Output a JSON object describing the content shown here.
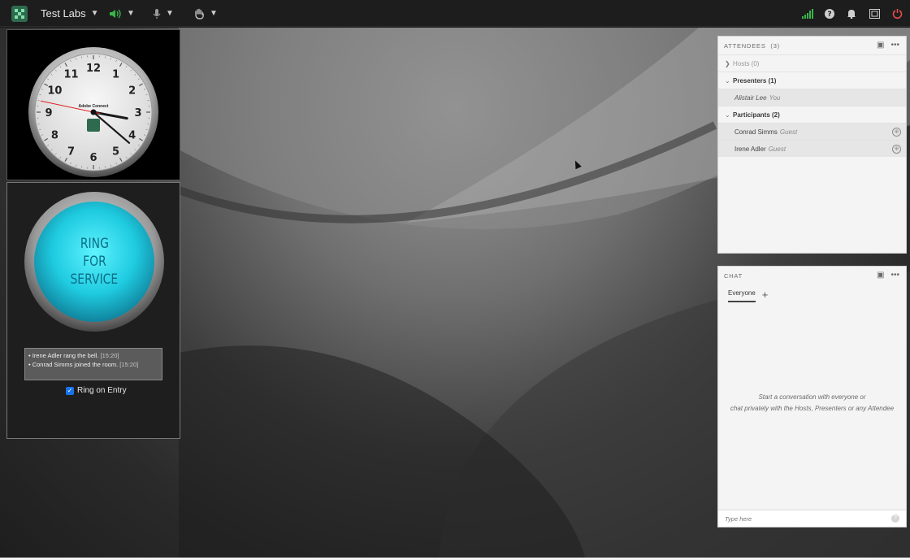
{
  "topbar": {
    "logo_icon": "adobe-connect-logo-icon",
    "room_name": "Test Labs",
    "audio_icon": "speaker-icon",
    "mic_icon": "microphone-icon",
    "hand_icon": "raise-hand-icon",
    "right_icons": [
      "signal-icon",
      "help-icon",
      "bell-icon",
      "fullscreen-icon",
      "power-icon"
    ],
    "accent_green": "#39b54a",
    "power_red": "#e44c4c"
  },
  "clock": {
    "brand": "Adobe Connect",
    "numerals": [
      "12",
      "1",
      "2",
      "3",
      "4",
      "5",
      "6",
      "7",
      "8",
      "9",
      "10",
      "11"
    ],
    "time_hour": 3,
    "time_minute": 21,
    "time_second": 47
  },
  "ring": {
    "line1": "RING",
    "line2": "FOR",
    "line3": "SERVICE",
    "log": [
      {
        "text": "Irene Adler rang the bell.",
        "time": "[15:20]"
      },
      {
        "text": "Conrad Simms joined the room.",
        "time": "[15:20]"
      }
    ],
    "ring_on_entry_label": "Ring on Entry",
    "ring_on_entry_checked": true
  },
  "attendees": {
    "title": "ATTENDEES  (3)",
    "hosts_label": "Hosts (0)",
    "presenters_label": "Presenters (1)",
    "participants_label": "Participants (2)",
    "presenter": {
      "name": "Alistair Lee",
      "role": "You"
    },
    "participants": [
      {
        "name": "Conrad Simms",
        "role": "Guest"
      },
      {
        "name": "Irene Adler",
        "role": "Guest"
      }
    ]
  },
  "chat": {
    "title": "CHAT",
    "tab_label": "Everyone",
    "add_label": "+",
    "empty_line1": "Start a conversation with everyone or",
    "empty_line2": "chat privately with the Hosts, Presenters or any Attendee",
    "input_placeholder": "Type here"
  }
}
